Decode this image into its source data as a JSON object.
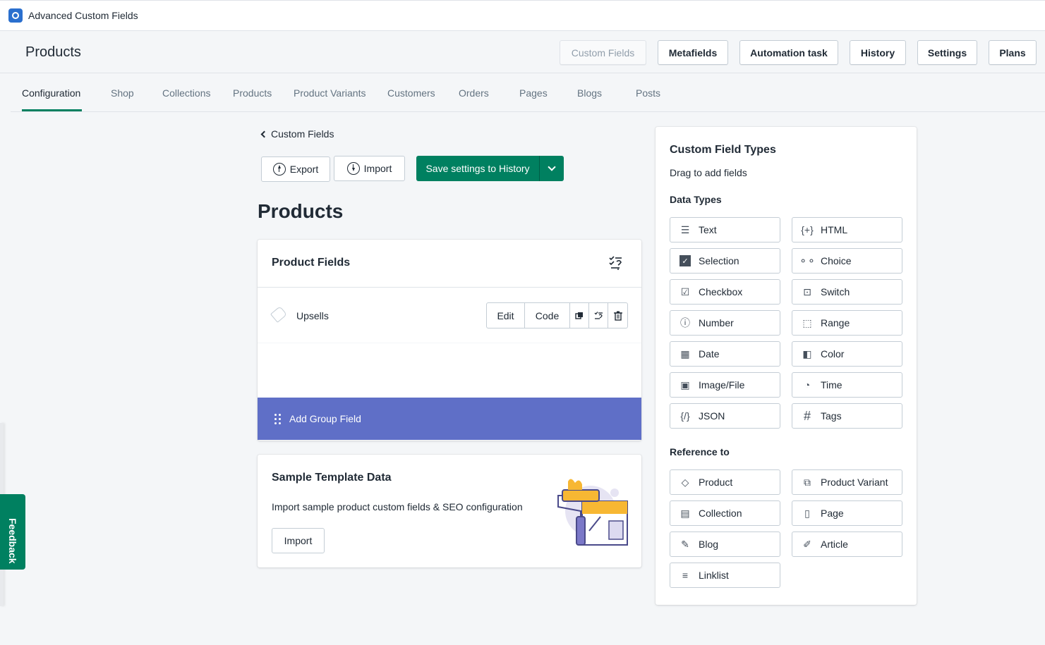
{
  "app": {
    "name": "Advanced Custom Fields"
  },
  "header": {
    "title": "Products",
    "buttons": [
      "Custom Fields",
      "Metafields",
      "Automation task",
      "History",
      "Settings",
      "Plans"
    ]
  },
  "tabs": [
    "Configuration",
    "Shop",
    "Collections",
    "Products",
    "Product Variants",
    "Customers",
    "Orders",
    "Pages",
    "Blogs",
    "Posts"
  ],
  "toolbar": {
    "back": "Custom Fields",
    "export": "Export",
    "import": "Import",
    "save": "Save settings to History"
  },
  "main": {
    "heading": "Products",
    "fields_card": {
      "title": "Product Fields",
      "field": {
        "label": "Upsells",
        "edit": "Edit",
        "code": "Code"
      },
      "add_group": "Add Group Field"
    },
    "sample_card": {
      "title": "Sample Template Data",
      "desc": "Import sample product custom fields & SEO configuration",
      "button": "Import"
    }
  },
  "sidebar": {
    "title": "Custom Field Types",
    "subtitle": "Drag to add fields",
    "data_types_heading": "Data Types",
    "data_types": [
      {
        "label": "Text",
        "icon": "text-icon"
      },
      {
        "label": "HTML",
        "icon": "html-icon"
      },
      {
        "label": "Selection",
        "icon": "selection-icon"
      },
      {
        "label": "Choice",
        "icon": "choice-icon"
      },
      {
        "label": "Checkbox",
        "icon": "checkbox-icon"
      },
      {
        "label": "Switch",
        "icon": "switch-icon"
      },
      {
        "label": "Number",
        "icon": "number-icon"
      },
      {
        "label": "Range",
        "icon": "range-icon"
      },
      {
        "label": "Date",
        "icon": "calendar-icon"
      },
      {
        "label": "Color",
        "icon": "color-icon"
      },
      {
        "label": "Image/File",
        "icon": "image-icon"
      },
      {
        "label": "Time",
        "icon": "time-icon"
      },
      {
        "label": "JSON",
        "icon": "json-icon"
      },
      {
        "label": "Tags",
        "icon": "hash-icon"
      }
    ],
    "reference_heading": "Reference to",
    "references": [
      {
        "label": "Product",
        "icon": "tag-icon"
      },
      {
        "label": "Product Variant",
        "icon": "variant-icon"
      },
      {
        "label": "Collection",
        "icon": "collection-icon"
      },
      {
        "label": "Page",
        "icon": "page-icon"
      },
      {
        "label": "Blog",
        "icon": "blog-icon"
      },
      {
        "label": "Article",
        "icon": "pencil-icon"
      },
      {
        "label": "Linklist",
        "icon": "list-icon"
      }
    ]
  },
  "feedback": "Feedback",
  "colors": {
    "primary": "#008060",
    "add_group": "#5f6fc7"
  }
}
